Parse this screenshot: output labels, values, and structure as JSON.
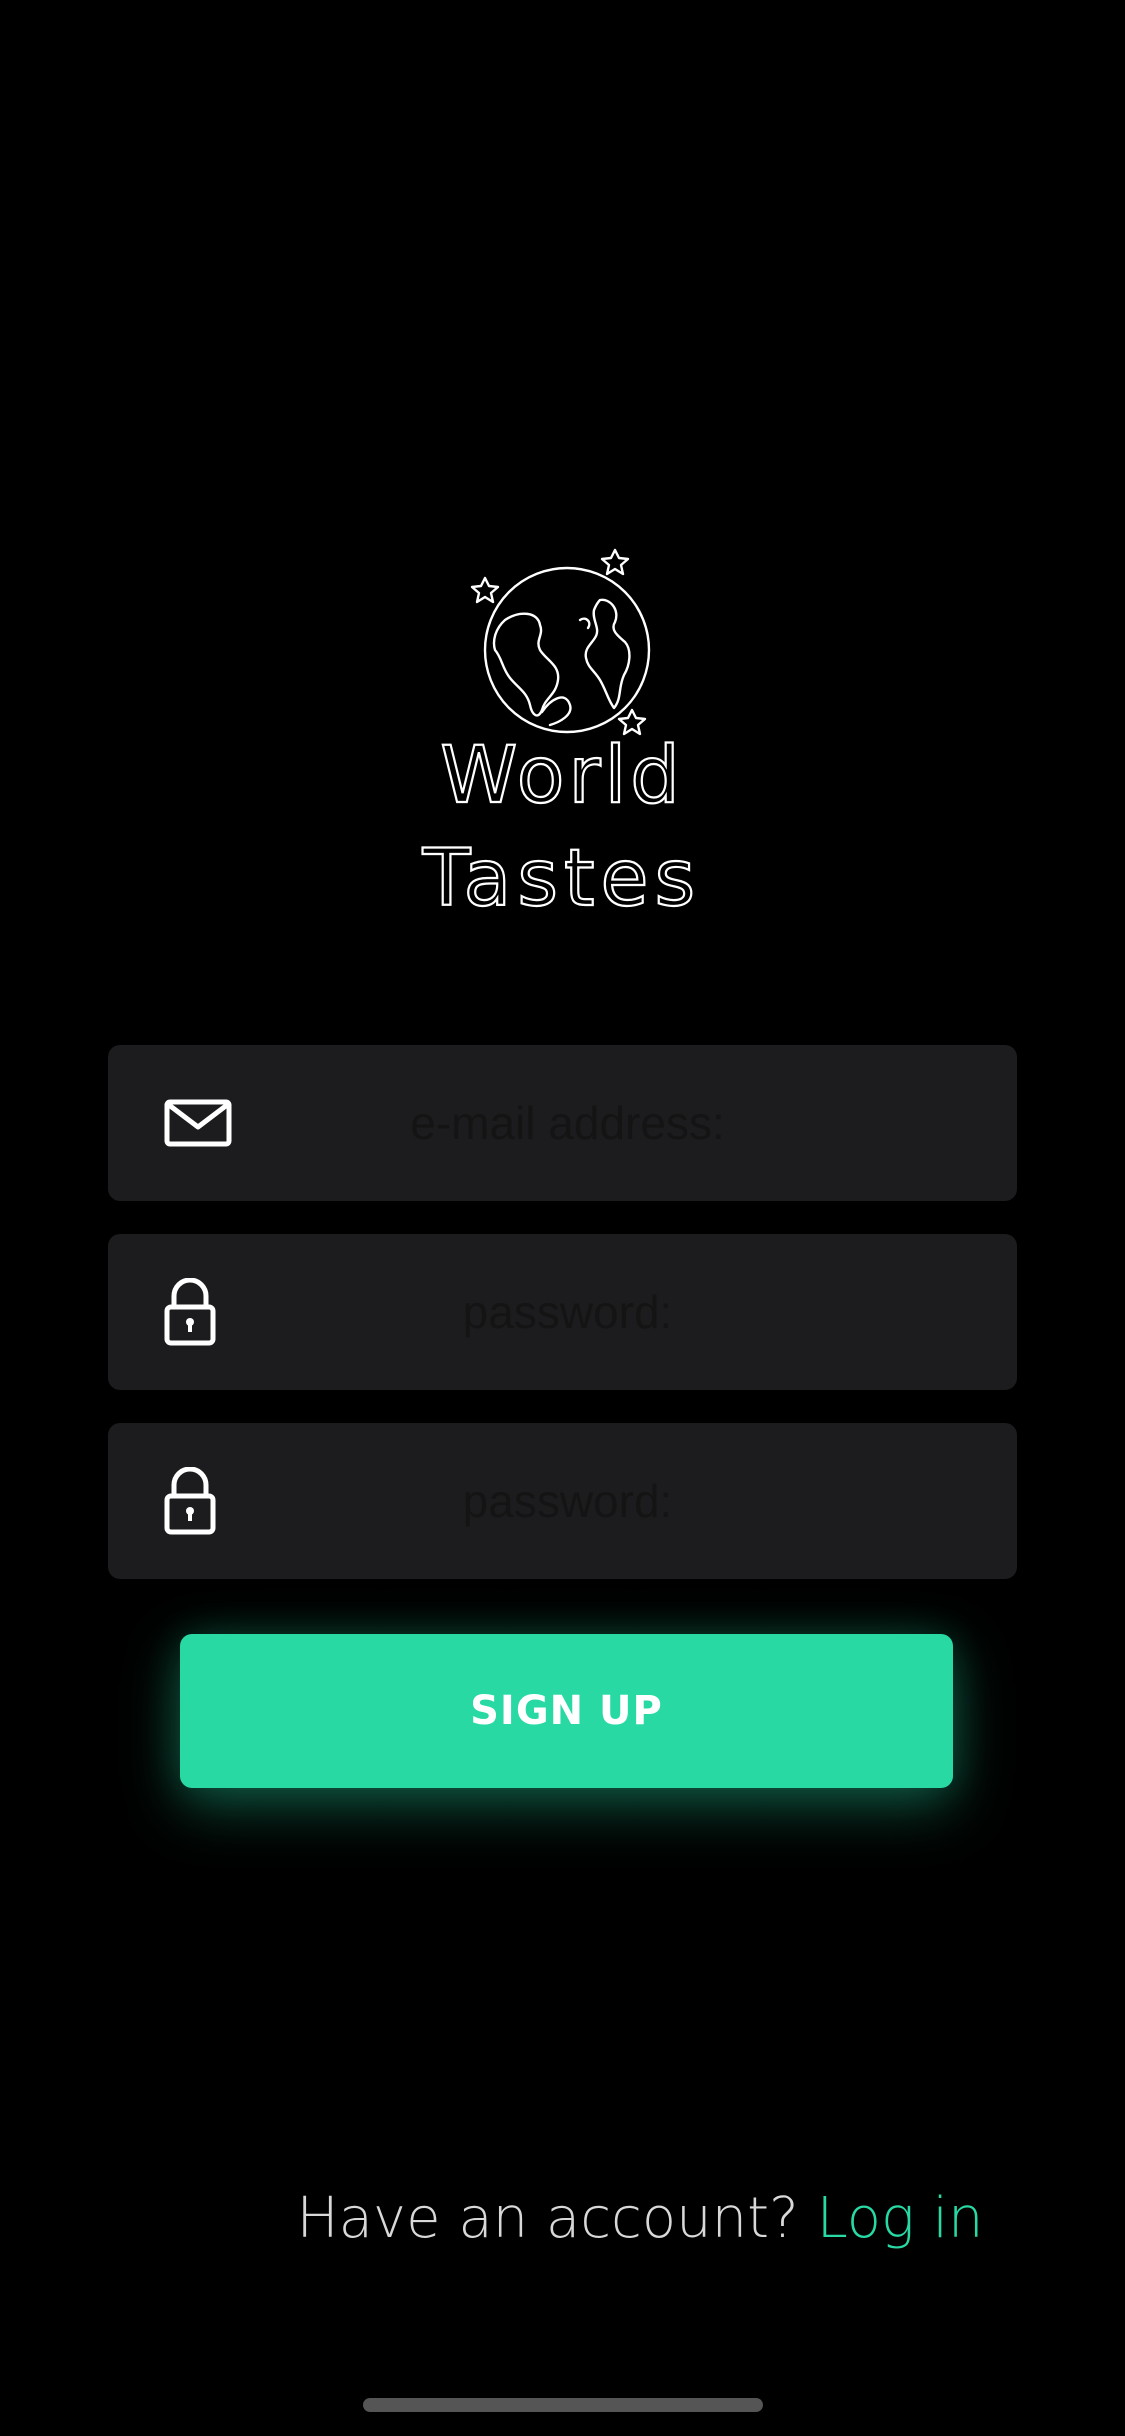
{
  "app": {
    "logo_line1": "World",
    "logo_line2": "Tastes"
  },
  "form": {
    "email": {
      "placeholder": "e-mail address:",
      "value": "",
      "icon": "mail-icon"
    },
    "password": {
      "placeholder": "password:",
      "value": "",
      "icon": "lock-icon"
    },
    "password_confirm": {
      "placeholder": "password:",
      "value": "",
      "icon": "lock-icon"
    },
    "submit_label": "SIGN UP"
  },
  "footer": {
    "prompt": "Have an account?",
    "link_label": "Log in"
  },
  "colors": {
    "background": "#000000",
    "field_background": "#1c1c1e",
    "accent": "#28d9a3",
    "text": "#ffffff"
  }
}
